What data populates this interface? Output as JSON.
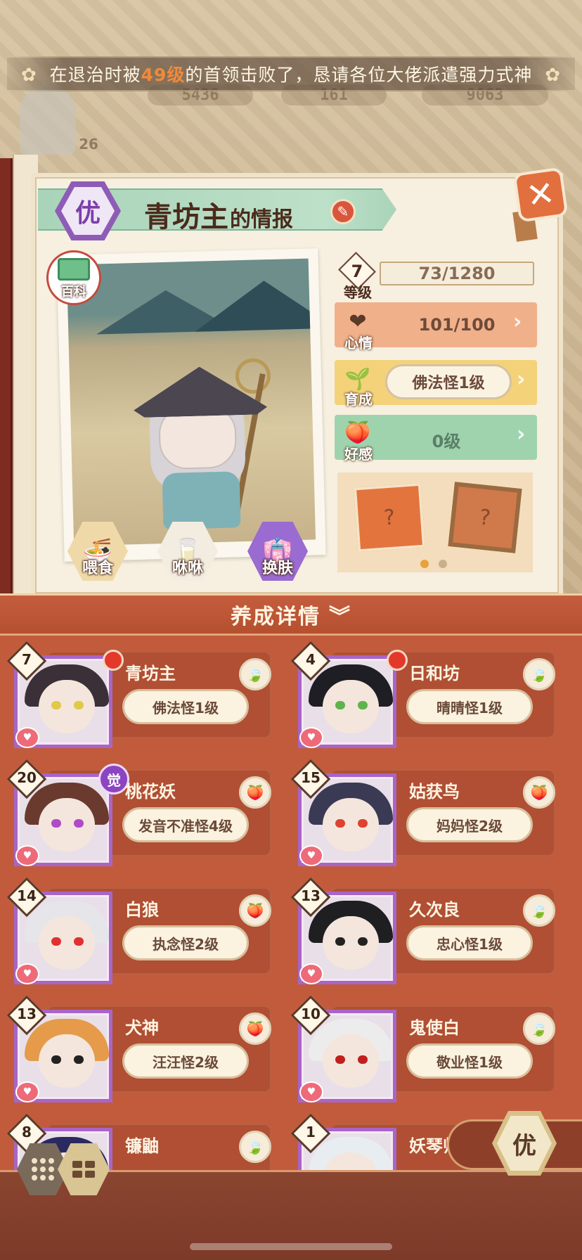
{
  "notice": {
    "prefix": "在退治时被",
    "level": "49级",
    "suffix": "的首领击败了，恳请各位大佬派遣强力式神"
  },
  "resources": {
    "faded_level": "26",
    "r1": "5436",
    "r2": "161",
    "r3": "9063"
  },
  "info": {
    "rank": "优",
    "name": "青坊主",
    "name_suffix": "的情报",
    "encyclopedia_label": "百科",
    "actions": {
      "feed": "喂食",
      "milk": "咻咻",
      "skin": "换肤"
    },
    "level": {
      "value": "7",
      "label": "等级",
      "exp": "73/1280"
    },
    "mood": {
      "label": "心情",
      "value": "101/100"
    },
    "growth": {
      "label": "育成",
      "value": "佛法怪1级"
    },
    "affinity": {
      "label": "好感",
      "value": "0级"
    }
  },
  "details_header": "养成详情",
  "characters": [
    {
      "level": "7",
      "name": "青坊主",
      "tag": "佛法怪1级",
      "leaf": "green",
      "red_dot": true,
      "awaken": false
    },
    {
      "level": "4",
      "name": "日和坊",
      "tag": "晴晴怪1级",
      "leaf": "green",
      "red_dot": true,
      "awaken": false
    },
    {
      "level": "20",
      "name": "桃花妖",
      "tag": "发音不准怪4级",
      "leaf": "peach",
      "red_dot": false,
      "awaken": true
    },
    {
      "level": "15",
      "name": "姑获鸟",
      "tag": "妈妈怪2级",
      "leaf": "peach",
      "red_dot": false,
      "awaken": false
    },
    {
      "level": "14",
      "name": "白狼",
      "tag": "执念怪2级",
      "leaf": "peach",
      "red_dot": false,
      "awaken": false
    },
    {
      "level": "13",
      "name": "久次良",
      "tag": "忠心怪1级",
      "leaf": "green",
      "red_dot": false,
      "awaken": false
    },
    {
      "level": "13",
      "name": "犬神",
      "tag": "汪汪怪2级",
      "leaf": "peach",
      "red_dot": false,
      "awaken": false
    },
    {
      "level": "10",
      "name": "鬼使白",
      "tag": "敬业怪1级",
      "leaf": "green",
      "red_dot": false,
      "awaken": false
    },
    {
      "level": "8",
      "name": "镰鼬",
      "tag": "",
      "leaf": "green",
      "red_dot": false,
      "awaken": false
    },
    {
      "level": "1",
      "name": "妖琴师",
      "tag": "",
      "leaf": "green",
      "red_dot": false,
      "awaken": false
    }
  ],
  "awaken_label": "觉",
  "bottom": {
    "rank_filter": "优"
  },
  "colors": {
    "panel": "#c25b3c",
    "portrait_border": "#a865c6",
    "mood_row": "#f0b08a",
    "growth_row": "#f4d27a",
    "affinity_row": "#9fd3ae"
  }
}
